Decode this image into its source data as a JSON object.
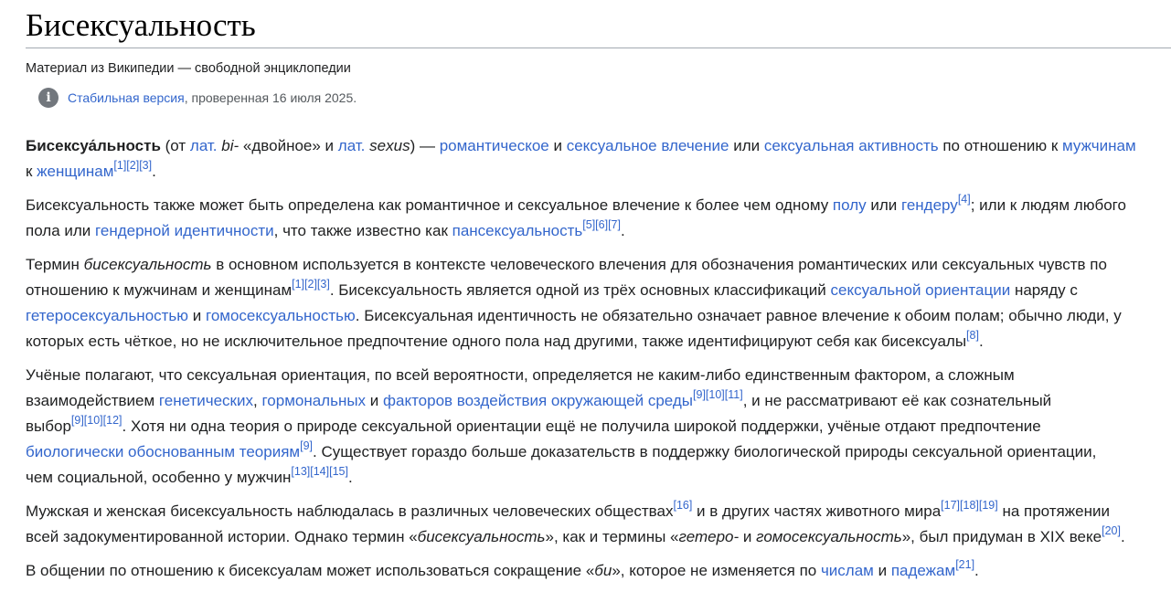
{
  "page": {
    "title": "Бисексуальность",
    "tagline": "Материал из Википедии — свободной энциклопедии",
    "stable_link": "Стабильная версия",
    "stable_rest": ", проверенная 16 июля 2025."
  },
  "p1": {
    "b": "Бисексуа́льность",
    "t1": " (от ",
    "lat1": "лат.",
    "t2": " ",
    "i1": "bi-",
    "t3": " «двойное» и ",
    "lat2": "лат.",
    "t4": " ",
    "i2": "sexus",
    "t5": ") — ",
    "a1": "романтическое",
    "t6": " и ",
    "a2": "сексуальное влечение",
    "t7": " или ",
    "a3": "сексуальная активность",
    "t8": " по отношению к ",
    "a4": "мужчинам",
    "t9": "к ",
    "a5": "женщинам",
    "refs": "[1][2][3]",
    "end": "."
  },
  "p2": {
    "t1": "Бисексуальность также может быть определена как романтичное и сексуальное влечение к более чем одному ",
    "a1": "полу",
    "t2": " или ",
    "a2": "гендеру",
    "r1": "[4]",
    "t3": "; или к людям любого",
    "t4": "пола или ",
    "a3": "гендерной идентичности",
    "t5": ", что также известно как ",
    "a4": "пансексуальность",
    "r2": "[5][6][7]",
    "end": "."
  },
  "p3": {
    "t1": "Термин ",
    "i1": "бисексуальность",
    "t2": " в основном используется в контексте человеческого влечения для обозначения романтических или сексуальных чувств по",
    "t3": "отношению к мужчинам и женщинам",
    "r1": "[1][2][3]",
    "t4": ". Бисексуальность является одной из трёх основных классификаций ",
    "a1": "сексуальной ориентации",
    "t5": " наряду с",
    "a2": "гетеросексуальностью",
    "t6": " и ",
    "a3": "гомосексуальностью",
    "t7": ". Бисексуальная идентичность не обязательно означает равное влечение к обоим полам; обычно люди, у",
    "t8": "которых есть чёткое, но не исключительное предпочтение одного пола над другими, также идентифицируют себя как бисексуалы",
    "r2": "[8]",
    "end": "."
  },
  "p4": {
    "t1": "Учёные полагают, что сексуальная ориентация, по всей вероятности, определяется не каким-либо единственным фактором, а сложным",
    "t2": "взаимодействием ",
    "a1": "генетических",
    "t3": ", ",
    "a2": "гормональных",
    "t4": " и ",
    "a3": "факторов воздействия окружающей среды",
    "r1": "[9][10][11]",
    "t5": ", и не рассматривают её как сознательный",
    "t6": "выбор",
    "r2": "[9][10][12]",
    "t7": ". Хотя ни одна теория о природе сексуальной ориентации ещё не получила широкой поддержки, учёные отдают предпочтение",
    "a4": "биологически обоснованным теориям",
    "r3": "[9]",
    "t8": ". Существует гораздо больше доказательств в поддержку биологической природы сексуальной ориентации,",
    "t9": "чем социальной, особенно у мужчин",
    "r4": "[13][14][15]",
    "end": "."
  },
  "p5": {
    "t1": "Мужская и женская бисексуальность наблюдалась в различных человеческих обществах",
    "r1": "[16]",
    "t2": " и в других частях животного мира",
    "r2": "[17][18][19]",
    "t3": " на протяжении",
    "t4": "всей задокументированной истории. Однако термин «",
    "i1": "бисексуальность",
    "t5": "», как и термины «",
    "i2": "гетеро-",
    "t6": " и ",
    "i3": "гомосексуальность",
    "t7": "», был придуман в XIX веке",
    "r3": "[20]",
    "end": "."
  },
  "p6": {
    "t1": "В общении по отношению к бисексуалам может использоваться сокращение «",
    "i1": "би",
    "t2": "», которое не изменяется по ",
    "a1": "числам",
    "t3": " и ",
    "a2": "падежам",
    "r1": "[21]",
    "end": "."
  }
}
